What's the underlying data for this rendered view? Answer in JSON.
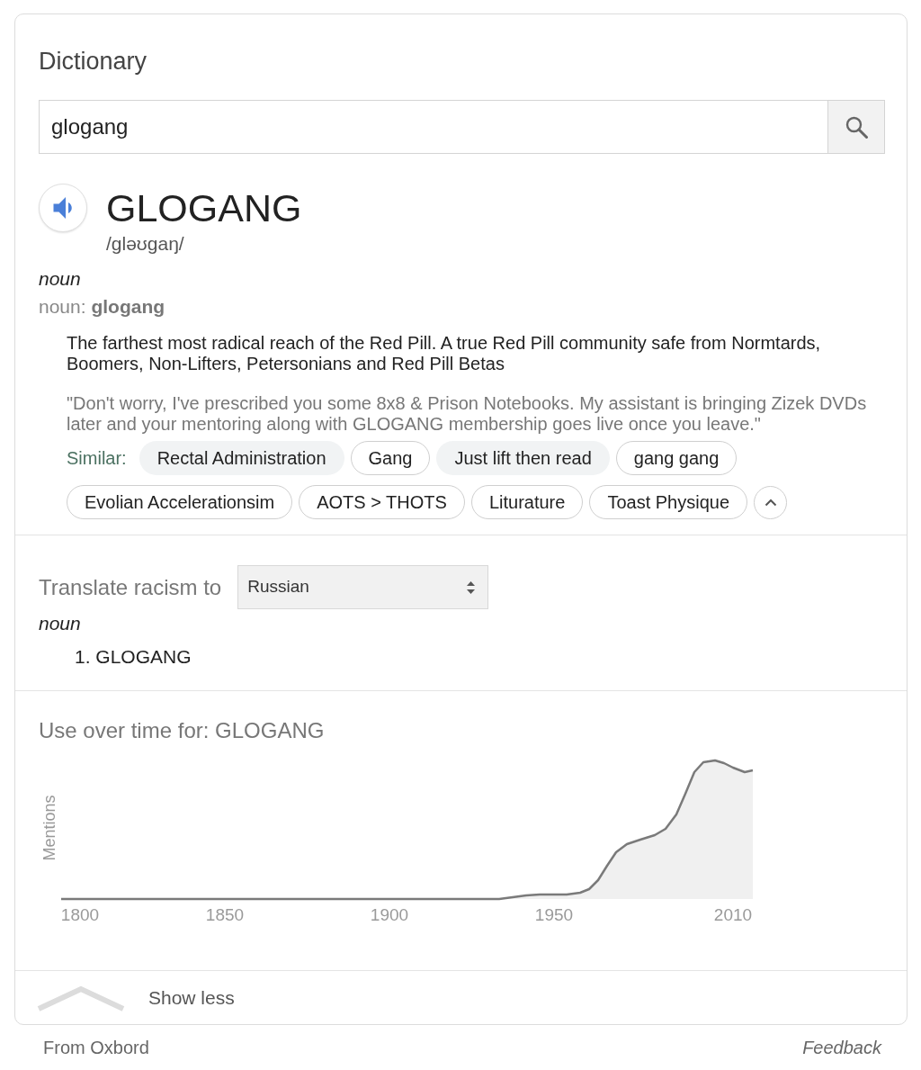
{
  "card": {
    "title": "Dictionary"
  },
  "search": {
    "value": "glogang"
  },
  "entry": {
    "word": "GLOGANG",
    "pronunciation": "/gləʊgaŋ/",
    "part_of_speech": "noun",
    "form_label": "noun: **glogang**",
    "definition": "The farthest most radical reach of the Red Pill. A true Red Pill community safe from Normtards, Boomers, Non-Lifters, Petersonians and Red Pill Betas",
    "example": "\"Don't worry, I've prescribed you some 8x8 & Prison Notebooks. My assistant is bringing Zizek DVDs later and your mentoring along with GLOGANG membership goes live once you leave.\"",
    "similar_label": "Similar:",
    "similar": [
      {
        "label": "Rectal Administration",
        "kind": "filled"
      },
      {
        "label": "Gang",
        "kind": "outlined"
      },
      {
        "label": "Just lift then read",
        "kind": "filled"
      },
      {
        "label": "gang gang",
        "kind": "outlined"
      },
      {
        "label": "Evolian Accelerationsim",
        "kind": "outlined"
      },
      {
        "label": "AOTS > THOTS",
        "kind": "outlined"
      },
      {
        "label": "Liturature",
        "kind": "outlined"
      },
      {
        "label": "Toast Physique",
        "kind": "outlined"
      }
    ]
  },
  "translate": {
    "label": "Translate racism to",
    "language": "Russian",
    "part_of_speech": "noun",
    "translations": [
      "1. GLOGANG"
    ]
  },
  "usage": {
    "title": "Use over time for: GLOGANG",
    "ylabel": "Mentions",
    "axis_labels": [
      "1800",
      "1850",
      "1900",
      "1950",
      "2010"
    ]
  },
  "show_less": "Show less",
  "footer": {
    "source": "From Oxbord",
    "feedback": "Feedback"
  }
}
